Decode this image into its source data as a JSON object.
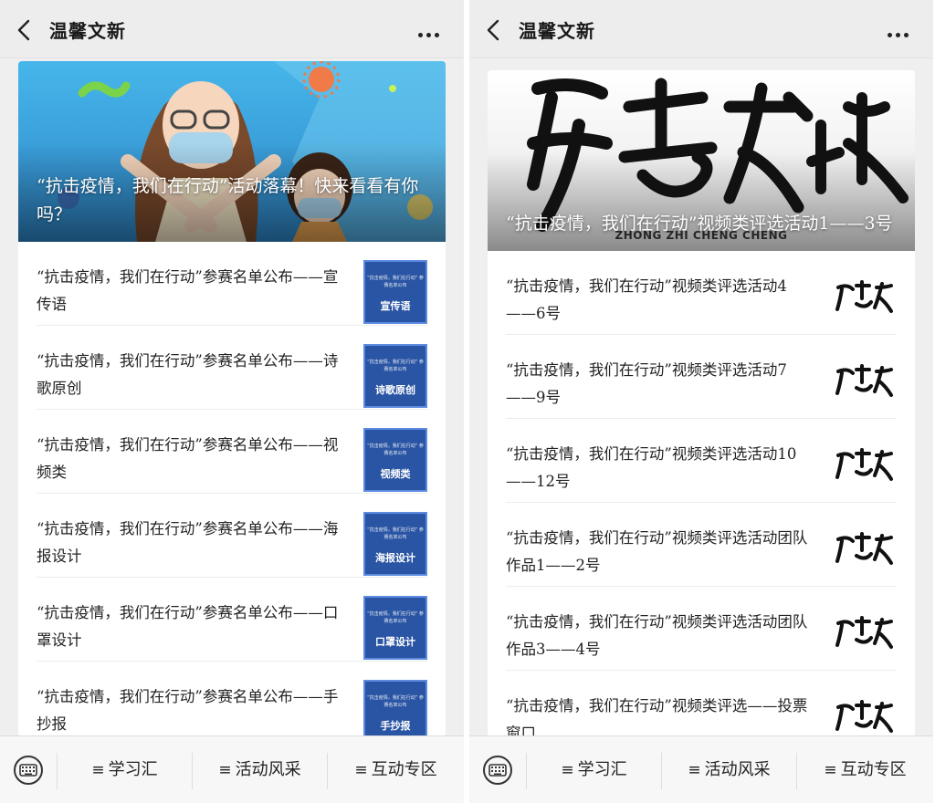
{
  "left": {
    "header": {
      "title": "温馨文新"
    },
    "hero": {
      "title": "“抗击疫情，我们在行动”活动落幕！快来看看有你吗？"
    },
    "items": [
      {
        "text": "“抗击疫情，我们在行动”参赛名单公布——宣传语",
        "thumb_label": "宣传语"
      },
      {
        "text": "“抗击疫情，我们在行动”参赛名单公布——诗歌原创",
        "thumb_label": "诗歌原创"
      },
      {
        "text": "“抗击疫情，我们在行动”参赛名单公布——视频类",
        "thumb_label": "视频类"
      },
      {
        "text": "“抗击疫情，我们在行动”参赛名单公布——海报设计",
        "thumb_label": "海报设计"
      },
      {
        "text": "“抗击疫情，我们在行动”参赛名单公布——口罩设计",
        "thumb_label": "口罩设计"
      },
      {
        "text": "“抗击疫情，我们在行动”参赛名单公布——手抄报",
        "thumb_label": "手抄报"
      }
    ],
    "thumb_caption": "“抗击疫情，我们在行动” 参赛名单公布",
    "tabs": [
      "学习汇",
      "活动风采",
      "互动专区"
    ]
  },
  "right": {
    "header": {
      "title": "温馨文新"
    },
    "hero": {
      "title": "“抗击疫情，我们在行动”视频类评选活动1——3号",
      "logo_caption": "ZHONG ZHI CHENG CHENG"
    },
    "items": [
      {
        "text": "“抗击疫情，我们在行动”视频类评选活动4——6号"
      },
      {
        "text": "“抗击疫情，我们在行动”视频类评选活动7——9号"
      },
      {
        "text": "“抗击疫情，我们在行动”视频类评选活动10——12号"
      },
      {
        "text": "“抗击疫情，我们在行动”视频类评选活动团队作品1——2号"
      },
      {
        "text": "“抗击疫情，我们在行动”视频类评选活动团队作品3——4号"
      },
      {
        "text": "“抗击疫情，我们在行动”视频类评选——投票窗口"
      }
    ],
    "tabs": [
      "学习汇",
      "活动风采",
      "互动专区"
    ]
  },
  "colors": {
    "thumb_blue": "#2a55a4",
    "hero_sky": "#3fa9e0"
  },
  "icons": [
    "back-icon",
    "more-icon",
    "keyboard-icon",
    "menu-bars-icon"
  ]
}
